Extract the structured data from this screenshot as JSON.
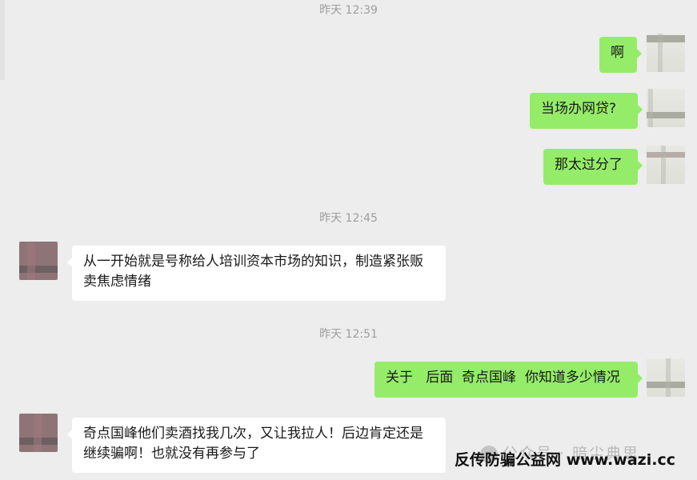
{
  "chat": {
    "timestamps": [
      "昨天 12:39",
      "昨天 12:45",
      "昨天 12:51"
    ],
    "messages": [
      {
        "sender": "me",
        "text": "啊"
      },
      {
        "sender": "me",
        "text": "当场办网贷?"
      },
      {
        "sender": "me",
        "text": "那太过分了"
      },
      {
        "sender": "contact",
        "text": "从一开始就是号称给人培训资本市场的知识，制造紧张贩卖焦虑情绪"
      },
      {
        "sender": "me",
        "text": "关于   后面  奇点国峰  你知道多少情况"
      },
      {
        "sender": "contact",
        "text": "奇点国峰他们卖酒找我几次，又让我拉人！后边肯定还是继续骗啊！也就没有再参与了"
      }
    ]
  },
  "watermark": {
    "text": "公众号 · 暗尘典思"
  },
  "brand": {
    "text": "反传防骗公益网 www.wazi.cc"
  }
}
